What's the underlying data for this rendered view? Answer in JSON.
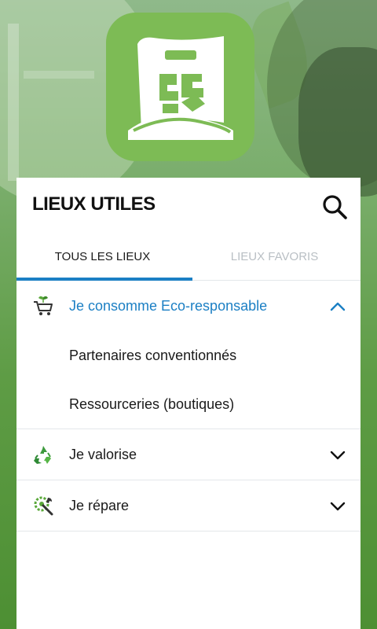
{
  "header": {
    "title": "LIEUX UTILES",
    "search_icon": "search-icon"
  },
  "tabs": [
    {
      "label": "TOUS LES LIEUX",
      "active": true
    },
    {
      "label": "LIEUX FAVORIS",
      "active": false
    }
  ],
  "sections": [
    {
      "label": "Je consomme Eco-responsable",
      "icon": "eco-cart-icon",
      "expanded": true,
      "items": [
        {
          "label": "Partenaires conventionnés"
        },
        {
          "label": "Ressourceries (boutiques)"
        }
      ]
    },
    {
      "label": "Je valorise",
      "icon": "recycle-icon",
      "expanded": false
    },
    {
      "label": "Je répare",
      "icon": "repair-wrench-icon",
      "expanded": false
    }
  ],
  "colors": {
    "accent": "#1b7fc4",
    "brand_green": "#7dbb55",
    "inactive_tab": "#b9bfc4"
  }
}
